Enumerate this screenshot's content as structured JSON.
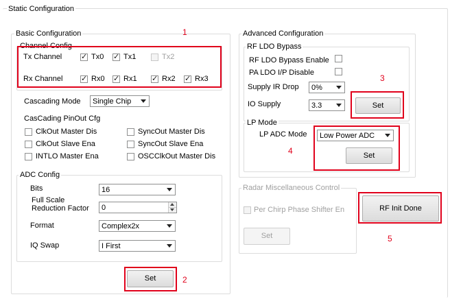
{
  "static_config": {
    "title": "Static Configuration"
  },
  "basic": {
    "title": "Basic Configuration",
    "channel": {
      "title": "Channel Config",
      "tx_label": "Tx Channel",
      "rx_label": "Rx Channel",
      "tx": [
        {
          "label": "Tx0",
          "checked": true,
          "enabled": true
        },
        {
          "label": "Tx1",
          "checked": true,
          "enabled": true
        },
        {
          "label": "Tx2",
          "checked": false,
          "enabled": false
        }
      ],
      "rx": [
        {
          "label": "Rx0",
          "checked": true,
          "enabled": true
        },
        {
          "label": "Rx1",
          "checked": true,
          "enabled": true
        },
        {
          "label": "Rx2",
          "checked": true,
          "enabled": true
        },
        {
          "label": "Rx3",
          "checked": true,
          "enabled": true
        }
      ]
    },
    "cascading_mode": {
      "label": "Cascading Mode",
      "value": "Single Chip"
    },
    "pinout": {
      "title": "CasCading PinOut Cfg",
      "items": [
        {
          "label": "ClkOut Master Dis",
          "checked": false
        },
        {
          "label": "SyncOut Master Dis",
          "checked": false
        },
        {
          "label": "ClkOut Slave Ena",
          "checked": false
        },
        {
          "label": "SyncOut Slave Ena",
          "checked": false
        },
        {
          "label": "INTLO Master Ena",
          "checked": false
        },
        {
          "label": "OSCClkOut Master Dis",
          "checked": false
        }
      ]
    },
    "adc": {
      "title": "ADC Config",
      "bits": {
        "label": "Bits",
        "value": "16"
      },
      "fsrf": {
        "label_line1": "Full Scale",
        "label_line2": "Reduction Factor",
        "value": "0"
      },
      "format": {
        "label": "Format",
        "value": "Complex2x"
      },
      "iq": {
        "label": "IQ Swap",
        "value": "I First"
      }
    },
    "set_label": "Set"
  },
  "advanced": {
    "title": "Advanced Configuration",
    "rf_ldo": {
      "title": "RF LDO Bypass",
      "bypass_enable": {
        "label": "RF LDO Bypass Enable",
        "checked": false
      },
      "pa_disable": {
        "label": "PA LDO I/P Disable",
        "checked": false
      },
      "ir_drop": {
        "label": "Supply IR Drop",
        "value": "0%"
      },
      "io_supply": {
        "label": "IO Supply",
        "value": "3.3"
      },
      "set_label": "Set"
    },
    "lp_mode": {
      "title": "LP Mode",
      "adc_mode": {
        "label": "LP ADC Mode",
        "value": "Low Power ADC"
      },
      "set_label": "Set"
    }
  },
  "radar_misc": {
    "title": "Radar Miscellaneous Control",
    "phase_shifter": {
      "label": "Per Chirp Phase Shifter En",
      "checked": false
    },
    "set_label": "Set"
  },
  "rf_init_done": {
    "label": "RF Init Done"
  },
  "annotations": {
    "color": "#e0001a",
    "numbers": [
      "1",
      "2",
      "3",
      "4",
      "5"
    ]
  }
}
